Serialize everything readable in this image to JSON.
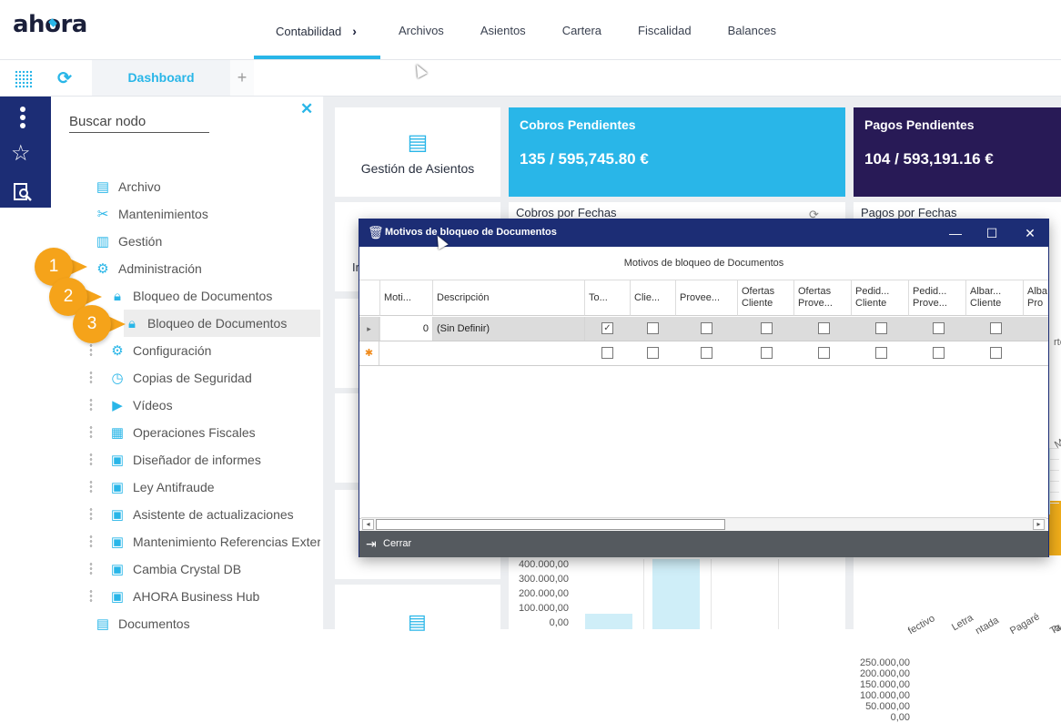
{
  "app": {
    "logo_left": "ah",
    "logo_o": "o",
    "logo_right": "ra"
  },
  "topnav": [
    {
      "label": "Contabilidad",
      "active": true
    },
    {
      "label": "Archivos"
    },
    {
      "label": "Asientos"
    },
    {
      "label": "Cartera"
    },
    {
      "label": "Fiscalidad"
    },
    {
      "label": "Balances"
    }
  ],
  "tabs": {
    "dashboard": "Dashboard",
    "add": "+"
  },
  "tree": {
    "search_placeholder": "Buscar nodo",
    "items": [
      {
        "label": "Archivo",
        "icon": "document-icon"
      },
      {
        "label": "Mantenimientos",
        "icon": "tools-icon"
      },
      {
        "label": "Gestión",
        "icon": "clipboard-icon"
      },
      {
        "label": "Administración",
        "icon": "gear-shield-icon"
      },
      {
        "label": "Bloqueo de Documentos",
        "icon": "lock-icon"
      },
      {
        "label": "Bloqueo de Documentos",
        "icon": "lock-icon"
      },
      {
        "label": "Configuración",
        "icon": "gear-icon"
      },
      {
        "label": "Copias de Seguridad",
        "icon": "backup-icon"
      },
      {
        "label": "Vídeos",
        "icon": "video-icon"
      },
      {
        "label": "Operaciones Fiscales",
        "icon": "calculator-icon"
      },
      {
        "label": "Diseñador de informes",
        "icon": "report-icon"
      },
      {
        "label": "Ley Antifraude",
        "icon": "report-icon"
      },
      {
        "label": "Asistente de actualizaciones",
        "icon": "report-icon"
      },
      {
        "label": "Mantenimiento Referencias Externas",
        "icon": "report-icon"
      },
      {
        "label": "Cambia Crystal DB",
        "icon": "report-icon"
      },
      {
        "label": "AHORA Business Hub",
        "icon": "report-icon"
      },
      {
        "label": "Documentos",
        "icon": "document-icon"
      }
    ]
  },
  "callouts": [
    "1",
    "2",
    "3"
  ],
  "dashboard": {
    "gestion": "Gestión de Asientos",
    "cobros": {
      "title": "Cobros Pendientes",
      "value": "135 / 595,745.80 €"
    },
    "pagos": {
      "title": "Pagos Pendientes",
      "value": "104 / 593,191.16 €"
    },
    "cobros_fechas": "Cobros por Fechas",
    "pagos_fechas": "Pagos por Fechas",
    "left_axis": [
      "400.000,00",
      "300.000,00",
      "200.000,00",
      "100.000,00",
      "0,00"
    ],
    "right_axis": [
      "250.000,00",
      "200.000,00",
      "150.000,00",
      "100.000,00",
      "50.000,00",
      "0,00"
    ],
    "right_x": [
      "fectivo",
      "Letra",
      "ntada",
      "Pagaré",
      "Ta"
    ],
    "partial_labels": {
      "me": "Me",
      "rte1": "rte",
      "rte2": "rte",
      "ir": "Ir"
    }
  },
  "dialog": {
    "title": "Motivos de bloqueo de Documentos",
    "subtitle": "Motivos de bloqueo de Documentos",
    "columns": [
      {
        "l1": "Moti...",
        "l2": ""
      },
      {
        "l1": "Descripción",
        "l2": ""
      },
      {
        "l1": "To...",
        "l2": ""
      },
      {
        "l1": "Clie...",
        "l2": ""
      },
      {
        "l1": "Provee...",
        "l2": ""
      },
      {
        "l1": "Ofertas",
        "l2": "Cliente"
      },
      {
        "l1": "Ofertas",
        "l2": "Prove..."
      },
      {
        "l1": "Pedid...",
        "l2": "Cliente"
      },
      {
        "l1": "Pedid...",
        "l2": "Prove..."
      },
      {
        "l1": "Albar...",
        "l2": "Cliente"
      },
      {
        "l1": "Alba",
        "l2": "Pro"
      }
    ],
    "rows": [
      {
        "indicator": "▸",
        "motivo": "0",
        "descripcion": "(Sin Definir)",
        "checks": [
          true,
          false,
          false,
          false,
          false,
          false,
          false,
          false
        ]
      },
      {
        "indicator": "✱",
        "motivo": "",
        "descripcion": "",
        "checks": [
          false,
          false,
          false,
          false,
          false,
          false,
          false,
          false
        ]
      }
    ],
    "footer_button": "Cerrar"
  }
}
